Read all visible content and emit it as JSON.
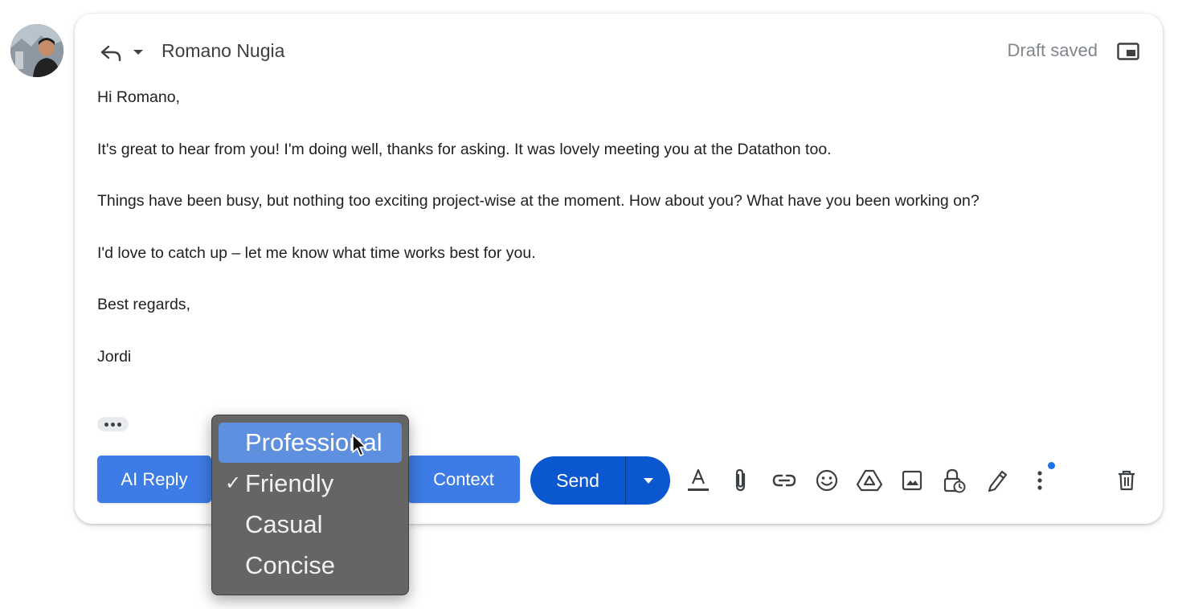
{
  "compose": {
    "recipient": "Romano Nugia",
    "draft_status": "Draft saved",
    "body": [
      "Hi Romano,",
      "It's great to hear from you! I'm doing well, thanks for asking. It was lovely meeting you at the Datathon too.",
      "Things have been busy, but nothing too exciting project-wise at the moment. How about you? What have you been working on?",
      "I'd love to catch up – let me know what time works best for you.",
      "Best regards,",
      "Jordi"
    ]
  },
  "toolbar": {
    "ai_reply_label": "AI Reply",
    "context_label": "Context",
    "send_label": "Send",
    "icons": [
      "text-format-icon",
      "attach-icon",
      "link-icon",
      "emoji-icon",
      "drive-icon",
      "image-icon",
      "confidential-icon",
      "signature-icon",
      "more-options-icon",
      "delete-icon"
    ]
  },
  "tone_menu": {
    "items": [
      {
        "label": "Professional",
        "highlighted": true,
        "checked": false
      },
      {
        "label": "Friendly",
        "highlighted": false,
        "checked": true
      },
      {
        "label": "Casual",
        "highlighted": false,
        "checked": false
      },
      {
        "label": "Concise",
        "highlighted": false,
        "checked": false
      }
    ],
    "check_glyph": "✓"
  },
  "colors": {
    "ai_button": "#3d7ce6",
    "send_button": "#0b57d0",
    "menu_highlight": "#5f8fdf",
    "menu_background": "#606060"
  }
}
